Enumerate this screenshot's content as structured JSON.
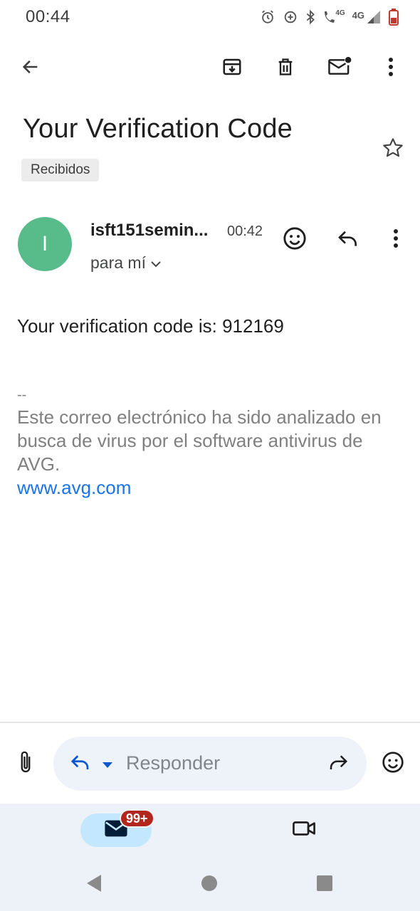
{
  "status_bar": {
    "time": "00:44",
    "network_label_small": "4G",
    "network_label_large": "4G"
  },
  "app_bar": {
    "back_icon": "arrow-left-icon",
    "archive_icon": "archive-icon",
    "delete_icon": "trash-icon",
    "mark_unread_icon": "mail-unread-icon",
    "more_icon": "more-vert-icon"
  },
  "email": {
    "subject": "Your Verification Code",
    "label": "Recibidos",
    "sender": {
      "avatar_initial": "I",
      "avatar_color": "#57bb8a",
      "name": "isft151semin...",
      "time": "00:42",
      "recipient": "para mí"
    },
    "body": "Your verification code is: 912169",
    "signature": {
      "separator": "--",
      "text": "Este correo electrónico ha sido analizado en busca de virus por el software antivirus de AVG.",
      "link": "www.avg.com"
    }
  },
  "reply_bar": {
    "placeholder": "Responder"
  },
  "bottom_nav": {
    "mail_badge": "99+",
    "badge_color": "#b3261e"
  },
  "colors": {
    "accent": "#1a73e8",
    "nav_bg": "#edf1f8",
    "active_tab": "#c2e7ff"
  }
}
